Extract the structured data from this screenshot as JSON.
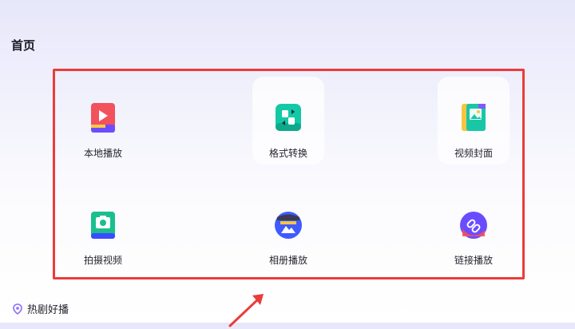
{
  "page": {
    "title": "首页"
  },
  "features": [
    {
      "label": "本地播放",
      "icon": "local-play-icon"
    },
    {
      "label": "格式转换",
      "icon": "format-convert-icon"
    },
    {
      "label": "视频封面",
      "icon": "video-cover-icon"
    },
    {
      "label": "拍摄视频",
      "icon": "camera-icon"
    },
    {
      "label": "相册播放",
      "icon": "album-icon"
    },
    {
      "label": "链接播放",
      "icon": "link-icon"
    }
  ],
  "hot_section": {
    "label": "热剧好播",
    "icon": "location-pin-icon"
  },
  "colors": {
    "highlight": "#ec3b3b",
    "accent_purple": "#7b5cff",
    "accent_teal": "#19c6a6"
  }
}
